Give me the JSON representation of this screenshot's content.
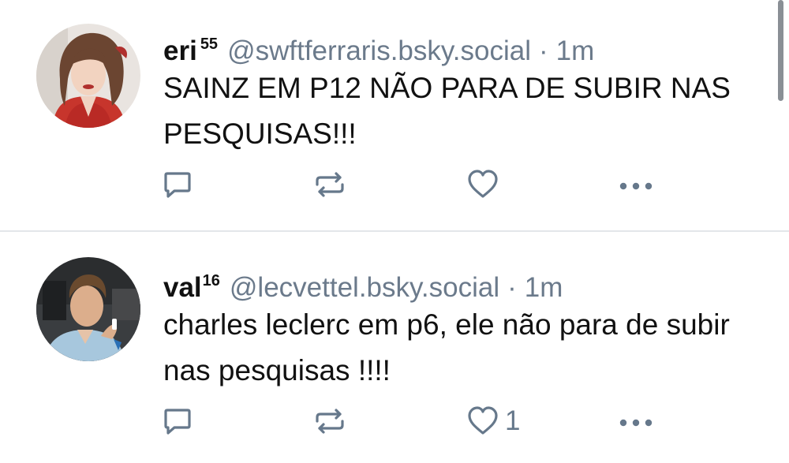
{
  "posts": [
    {
      "display_name": "eri",
      "name_superscript": "55",
      "handle": "@swftferraris.bsky.social",
      "separator": "·",
      "time": "1m",
      "text": "SAINZ EM P12 NÃO PARA DE SUBIR NAS PESQUISAS!!!",
      "like_count": ""
    },
    {
      "display_name": "val",
      "name_superscript": "16",
      "handle": "@lecvettel.bsky.social",
      "separator": "·",
      "time": "1m",
      "text": "charles leclerc em p6, ele não para de subir nas pesquisas !!!!",
      "like_count": "1"
    }
  ],
  "icons": {
    "reply": "reply-icon",
    "repost": "repost-icon",
    "like": "heart-icon",
    "more": "more-options-icon"
  },
  "colors": {
    "text": "#111111",
    "muted": "#6b7a8b",
    "icon": "#66788b",
    "divider": "#e3e6ea"
  }
}
